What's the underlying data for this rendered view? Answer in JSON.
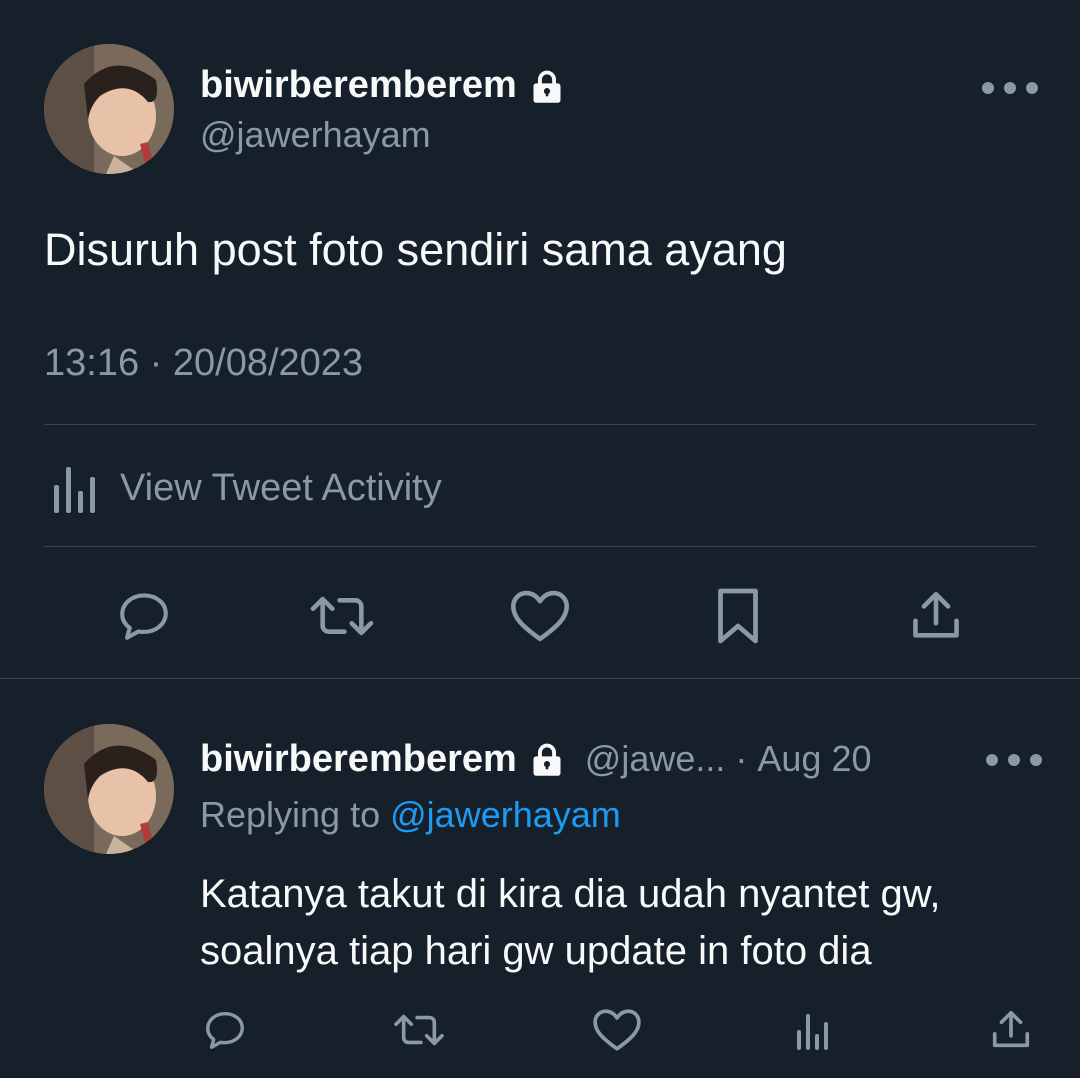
{
  "main_tweet": {
    "display_name": "biwirberemberem",
    "handle": "@jawerhayam",
    "text": "Disuruh post foto sendiri sama ayang",
    "timestamp": "13:16 · 20/08/2023",
    "activity_label": "View Tweet Activity",
    "icons": {
      "lock": "lock-icon",
      "more": "more-icon",
      "activity": "analytics-icon",
      "reply": "reply-icon",
      "retweet": "retweet-icon",
      "like": "like-icon",
      "bookmark": "bookmark-icon",
      "share": "share-icon"
    }
  },
  "reply_tweet": {
    "display_name": "biwirberemberem",
    "handle_truncated": "@jawe...",
    "separator": "·",
    "date": "Aug 20",
    "replying_prefix": "Replying to",
    "replying_mention": "@jawerhayam",
    "text_lines": [
      "Katanya takut di kira dia udah nyantet gw,",
      "soalnya tiap hari gw update in foto dia"
    ],
    "icons": {
      "reply": "reply-icon",
      "retweet": "retweet-icon",
      "like": "like-icon",
      "analytics": "analytics-icon",
      "share": "share-icon"
    }
  },
  "colors": {
    "background": "#15202b",
    "text_primary": "#f7f9f9",
    "text_secondary": "#8b98a5",
    "link": "#1d9bf0",
    "divider": "#38444d"
  }
}
